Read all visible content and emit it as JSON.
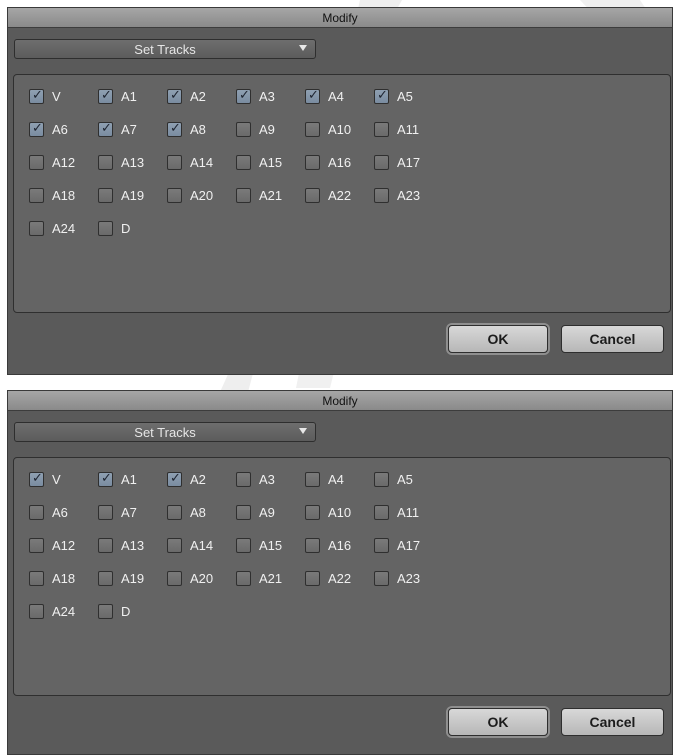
{
  "dialog_title": "Modify",
  "dropdown_value": "Set Tracks",
  "ok_label": "OK",
  "cancel_label": "Cancel",
  "tracks": [
    "V",
    "A1",
    "A2",
    "A3",
    "A4",
    "A5",
    "A6",
    "A7",
    "A8",
    "A9",
    "A10",
    "A11",
    "A12",
    "A13",
    "A14",
    "A15",
    "A16",
    "A17",
    "A18",
    "A19",
    "A20",
    "A21",
    "A22",
    "A23",
    "A24",
    "D"
  ],
  "dialogs": [
    {
      "checked": [
        "V",
        "A1",
        "A2",
        "A3",
        "A4",
        "A5",
        "A6",
        "A7",
        "A8"
      ]
    },
    {
      "checked": [
        "V",
        "A1",
        "A2"
      ]
    }
  ]
}
